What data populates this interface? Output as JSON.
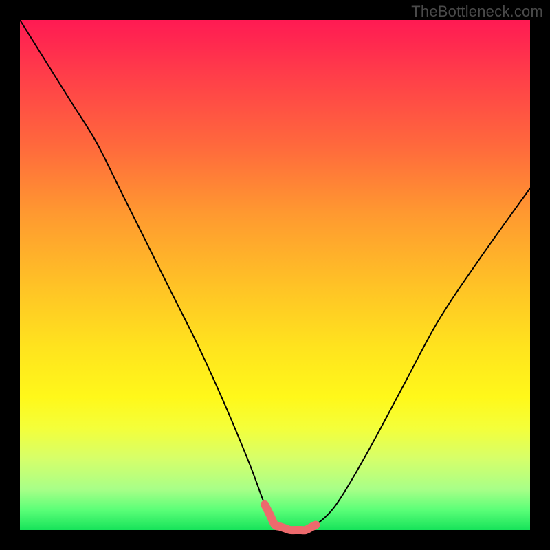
{
  "watermark": "TheBottleneck.com",
  "colors": {
    "frame": "#000000",
    "curve": "#000000",
    "highlight": "#ed6a6d",
    "gradient_top": "#ff1a53",
    "gradient_bottom": "#16e35a"
  },
  "chart_data": {
    "type": "line",
    "title": "",
    "xlabel": "",
    "ylabel": "",
    "xlim": [
      0,
      100
    ],
    "ylim": [
      0,
      100
    ],
    "note": "No axis tick labels shown; y increases upward; curve shows bottleneck % vs configuration, valley = least bottleneck",
    "series": [
      {
        "name": "bottleneck-curve",
        "x": [
          0,
          5,
          10,
          15,
          20,
          25,
          30,
          35,
          40,
          45,
          48,
          50,
          53,
          56,
          58,
          62,
          68,
          75,
          82,
          90,
          100
        ],
        "y": [
          100,
          92,
          84,
          76,
          66,
          56,
          46,
          36,
          25,
          13,
          5,
          1,
          0,
          0,
          1,
          5,
          15,
          28,
          41,
          53,
          67
        ]
      }
    ],
    "highlight_range_x": [
      48,
      58
    ]
  }
}
